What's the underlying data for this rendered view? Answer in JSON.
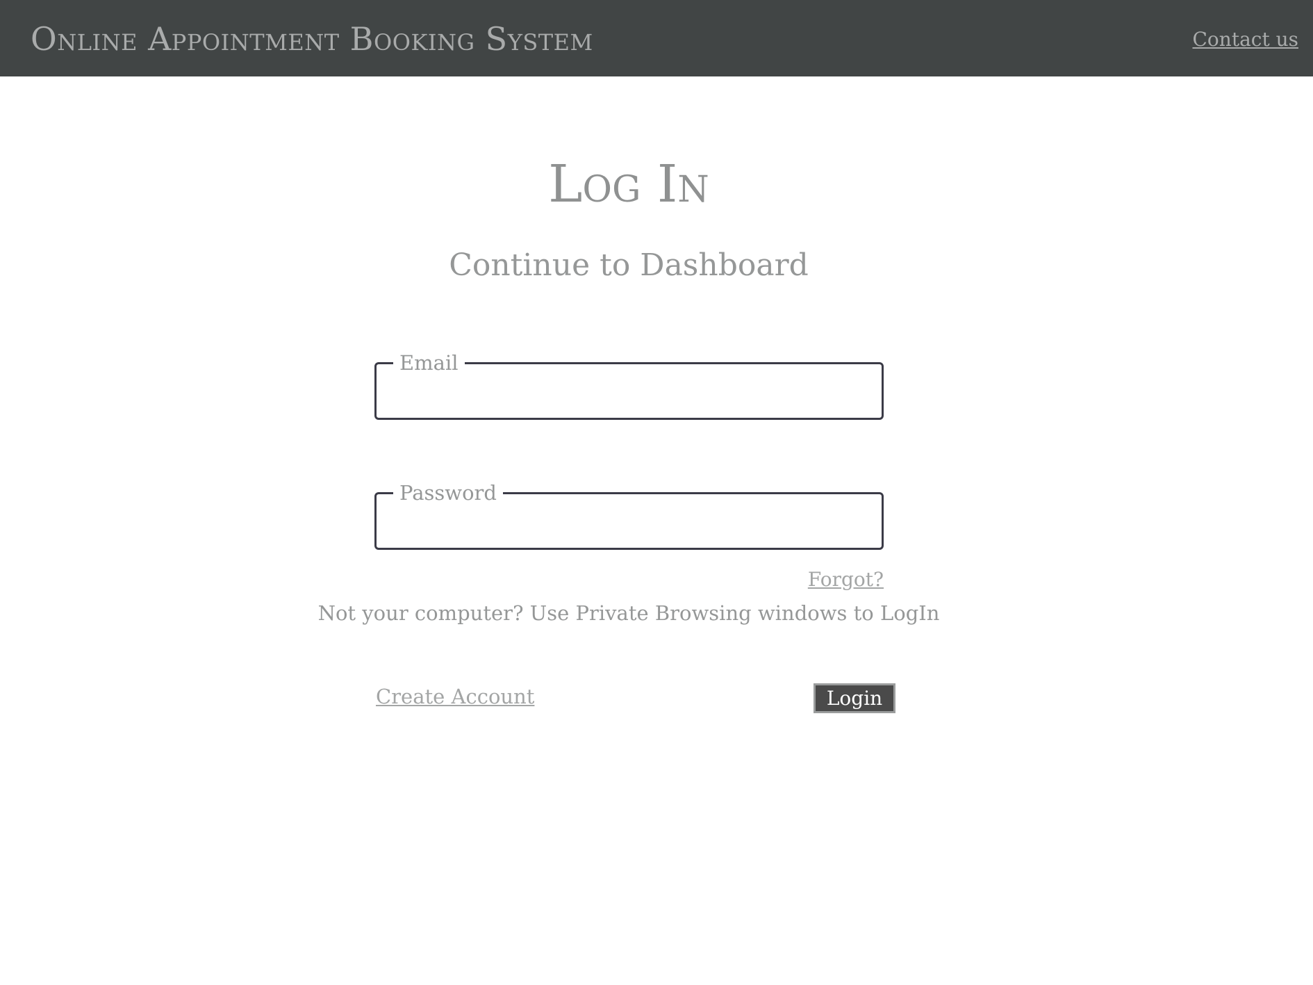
{
  "header": {
    "app_title": "Online Appointment Booking System",
    "contact_label": "Contact us"
  },
  "main": {
    "title": "Log In",
    "subtitle": "Continue to Dashboard"
  },
  "form": {
    "email": {
      "label": "Email",
      "value": "",
      "placeholder": ""
    },
    "password": {
      "label": "Password",
      "value": "",
      "placeholder": ""
    },
    "forgot_label": "Forgot?",
    "notice": "Not your computer? Use Private Browsing windows to LogIn",
    "create_account_label": "Create Account",
    "login_label": "Login"
  },
  "colors": {
    "header_bg": "#414545",
    "header_text": "#a9abab",
    "title_text": "#8f9191",
    "field_border": "#3b3b47",
    "button_bg": "#4a4a4a"
  }
}
